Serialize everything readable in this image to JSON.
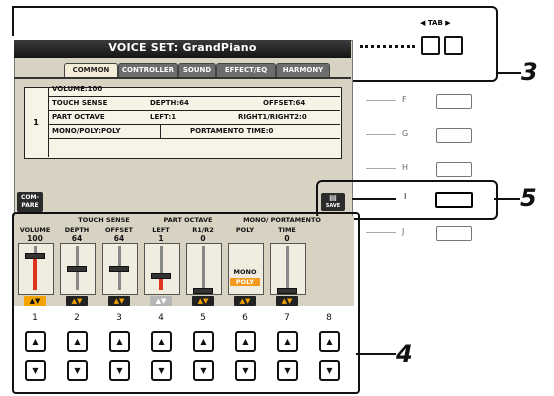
{
  "display": {
    "title": "VOICE SET: GrandPiano",
    "tabs": [
      "COMMON",
      "CONTROLLER",
      "SOUND",
      "EFFECT/EQ",
      "HARMONY"
    ],
    "active_tab": "COMMON",
    "params": {
      "part_number": "1",
      "volume": "VOLUME:100",
      "touch_sense": "TOUCH SENSE",
      "depth": "DEPTH:64",
      "offset": "OFFSET:64",
      "part_octave": "PART OCTAVE",
      "left": "LEFT:1",
      "right": "RIGHT1/RIGHT2:0",
      "mono_poly": "MONO/POLY:POLY",
      "portamento": "PORTAMENTO TIME:0"
    },
    "compare_label": "COM-PARE",
    "save_label": "SAVE"
  },
  "tab_panel": {
    "label": "TAB"
  },
  "side_buttons": [
    "F",
    "G",
    "H",
    "I",
    "J"
  ],
  "callouts": {
    "three": "3",
    "four": "4",
    "five": "5"
  },
  "strip": {
    "group_labels": {
      "touch": "TOUCH SENSE",
      "octave": "PART OCTAVE",
      "mono": "MONO/ PORTAMENTO"
    },
    "columns": [
      {
        "label": "VOLUME",
        "value": "100",
        "level": 100,
        "max": 127,
        "highlight": true,
        "disabled": false,
        "number": "1"
      },
      {
        "label": "DEPTH",
        "value": "64",
        "level": 64,
        "max": 127,
        "highlight": false,
        "disabled": false,
        "number": "2"
      },
      {
        "label": "OFFSET",
        "value": "64",
        "level": 64,
        "max": 127,
        "highlight": false,
        "disabled": false,
        "number": "3"
      },
      {
        "label": "LEFT",
        "value": "1",
        "level": 1,
        "max": 3,
        "highlight": true,
        "disabled": true,
        "number": "4"
      },
      {
        "label": "R1/R2",
        "value": "0",
        "level": 0,
        "max": 3,
        "highlight": false,
        "disabled": false,
        "number": "5"
      },
      {
        "label": "POLY",
        "value": "",
        "level": 0,
        "max": 1,
        "highlight": false,
        "disabled": false,
        "number": "6"
      },
      {
        "label": "TIME",
        "value": "0",
        "level": 0,
        "max": 127,
        "highlight": false,
        "disabled": false,
        "number": "7"
      },
      {
        "label": "",
        "value": "",
        "level": 0,
        "max": 1,
        "highlight": false,
        "disabled": false,
        "number": "8"
      }
    ],
    "mono_option": "MONO",
    "poly_option": "POLY",
    "up_glyph": "▲",
    "down_glyph": "▼"
  },
  "colors": {
    "accent_red": "#e0331c",
    "accent_orange": "#f3a200",
    "poly_orange": "#f39a1e"
  }
}
